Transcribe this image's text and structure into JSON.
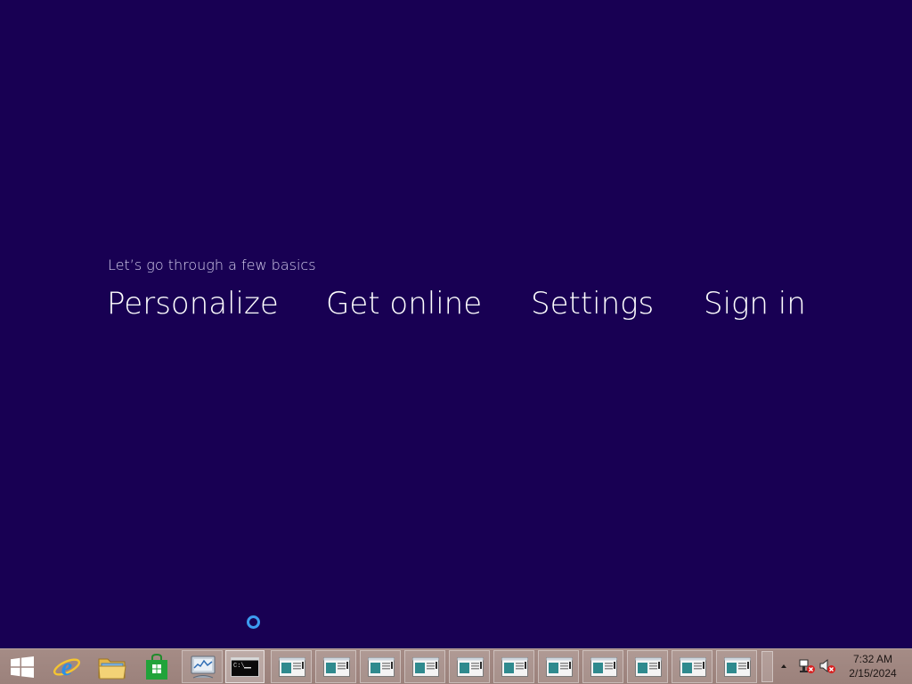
{
  "setup": {
    "background_color": "#180053",
    "subtitle": "Let’s go through a few basics",
    "steps": [
      "Personalize",
      "Get online",
      "Settings",
      "Sign in"
    ]
  },
  "taskbar": {
    "background_color": "#a08781",
    "pinned": [
      {
        "name": "start",
        "icon": "windows-logo-icon"
      },
      {
        "name": "internet-explorer",
        "icon": "internet-explorer-icon"
      },
      {
        "name": "file-explorer",
        "icon": "folder-icon"
      },
      {
        "name": "store",
        "icon": "store-bag-icon"
      },
      {
        "name": "performance-monitor",
        "icon": "performance-monitor-icon"
      },
      {
        "name": "command-prompt",
        "icon": "command-prompt-icon",
        "text": "C:\\"
      }
    ],
    "window_button_count": 11,
    "window_button_icon": "application-window-icon",
    "tray": {
      "expand_icon": "caret-up-icon",
      "network_icon": "network-disconnected-icon",
      "volume_icon": "volume-muted-icon",
      "time": "7:32 AM",
      "date": "2/15/2024"
    }
  }
}
